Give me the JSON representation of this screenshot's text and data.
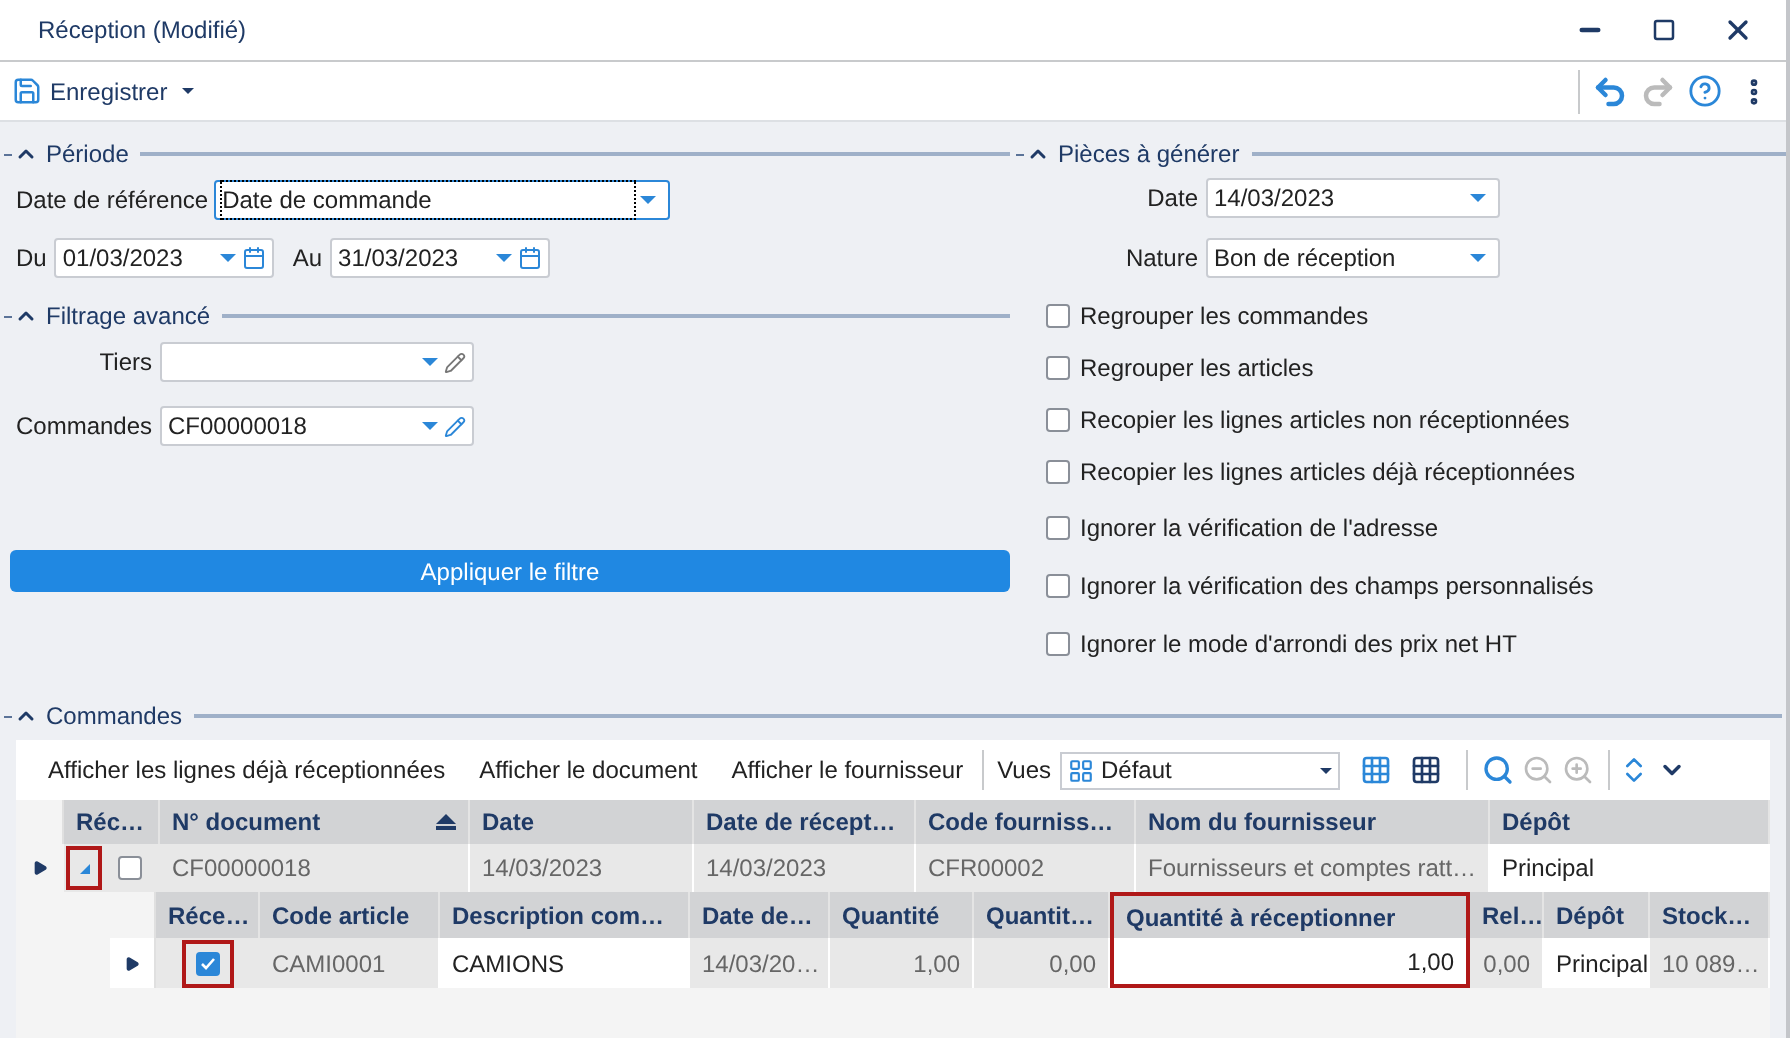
{
  "window": {
    "title": "Réception (Modifié)"
  },
  "toolbar": {
    "save": "Enregistrer"
  },
  "periode": {
    "title": "Période",
    "reference_label": "Date de référence",
    "reference_value": "Date de commande",
    "from_label": "Du",
    "from_value": "01/03/2023",
    "to_label": "Au",
    "to_value": "31/03/2023"
  },
  "filtrage": {
    "title": "Filtrage avancé",
    "tiers_label": "Tiers",
    "commandes_label": "Commandes",
    "commandes_value": "CF00000018",
    "apply": "Appliquer le filtre"
  },
  "pieces": {
    "title": "Pièces à générer",
    "date_label": "Date",
    "date_value": "14/03/2023",
    "nature_label": "Nature",
    "nature_value": "Bon de réception",
    "options": [
      {
        "label": "Regrouper les commandes",
        "checked": false
      },
      {
        "label": "Regrouper les articles",
        "checked": false
      },
      {
        "label": "Recopier les lignes articles non réceptionnées",
        "checked": false
      },
      {
        "label": "Recopier les lignes articles déjà réceptionnées",
        "checked": false
      },
      {
        "label": "Ignorer la vérification de l'adresse",
        "checked": false
      },
      {
        "label": "Ignorer la vérification des champs personnalisés",
        "checked": false
      },
      {
        "label": "Ignorer le mode d'arrondi des prix net HT",
        "checked": false
      }
    ]
  },
  "commandes": {
    "title": "Commandes",
    "actions": [
      "Afficher les lignes déjà réceptionnées",
      "Afficher le document",
      "Afficher le fournisseur"
    ],
    "views_label": "Vues",
    "view_value": "Défaut",
    "check_column": "Réc…",
    "columns": [
      {
        "label": "N° document",
        "sorted": true
      },
      {
        "label": "Date"
      },
      {
        "label": "Date de récept…"
      },
      {
        "label": "Code fourniss…"
      },
      {
        "label": "Nom du fournisseur"
      },
      {
        "label": "Dépôt",
        "editable": true
      }
    ],
    "rows": [
      {
        "checked": false,
        "expanded": true,
        "highlighted": true,
        "cells": [
          "CF00000018",
          "14/03/2023",
          "14/03/2023",
          "CFR00002",
          "Fournisseurs et comptes ratt…",
          "Principal"
        ],
        "child_check_column": "Réce…",
        "child_columns": [
          {
            "label": "Code article"
          },
          {
            "label": "Description com…",
            "editable": true
          },
          {
            "label": "Date de…"
          },
          {
            "label": "Quantité",
            "numeric": true
          },
          {
            "label": "Quantit…",
            "numeric": true
          },
          {
            "label": "Quantité à réceptionner",
            "numeric": true,
            "editable": true,
            "highlighted": true
          },
          {
            "label": "Rel…",
            "numeric": true
          },
          {
            "label": "Dépôt",
            "editable": true
          },
          {
            "label": "Stock…"
          }
        ],
        "children": [
          {
            "checked": true,
            "highlighted": true,
            "cells": [
              "CAMI0001",
              "CAMIONS",
              "14/03/20…",
              "1,00",
              "0,00",
              "1,00",
              "0,00",
              "Principal",
              "10 089…"
            ]
          }
        ]
      }
    ]
  }
}
